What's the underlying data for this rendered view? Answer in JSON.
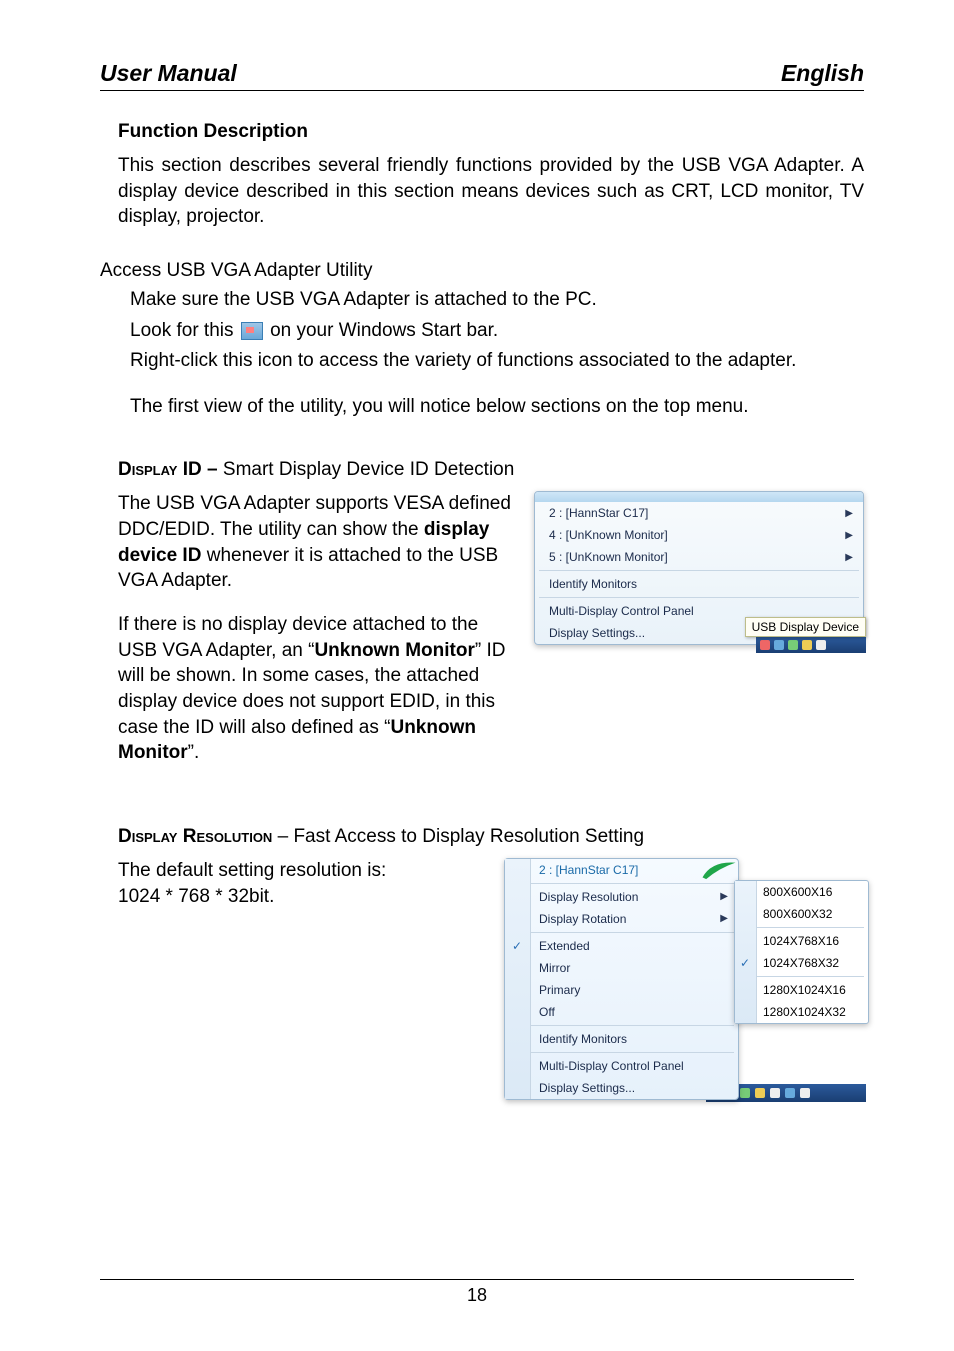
{
  "header": {
    "left": "User Manual",
    "right": "English"
  },
  "section1": {
    "title": "Function Description",
    "para": "This section describes several friendly functions provided by the USB VGA Adapter.  A display device described in this section means devices such as CRT, LCD monitor, TV display, projector."
  },
  "access": {
    "title": "Access USB VGA Adapter Utility",
    "line1": "Make sure the USB VGA Adapter is attached to the PC.",
    "look_pre": "Look for this ",
    "look_post": " on your Windows Start bar.",
    "line3": "Right-click this icon to access the variety of functions associated to the adapter.",
    "line4": "The first view of the utility, you will notice below sections on the top menu."
  },
  "display_id": {
    "heading_pre": "Display ID – ",
    "heading_post": "Smart Display Device ID Detection",
    "p1a": "The USB VGA Adapter supports VESA defined DDC/EDID.  The utility can show the ",
    "p1b": "display device ID",
    "p1c": " whenever it is attached to the USB VGA Adapter.",
    "p2a": "If there is no display device attached to the USB VGA Adapter, an “",
    "p2b": "Unknown Monitor",
    "p2c": "” ID will be shown.  In some cases, the attached display device does not support EDID, in this case the ID will also defined as “",
    "p2d": "Unknown Monitor",
    "p2e": "”."
  },
  "menu1": {
    "items": [
      "2 : [HannStar C17]",
      "4 : [UnKnown Monitor]",
      "5 : [UnKnown Monitor]"
    ],
    "identify": "Identify Monitors",
    "mdpanel": "Multi-Display Control Panel",
    "settings": "Display Settings...",
    "tooltip": "USB Display Device"
  },
  "display_res": {
    "heading_pre": "Display Resolution",
    "heading_post": " – Fast Access to Display Resolution Setting",
    "p1": "The default setting resolution is:",
    "p2": "1024 * 768 * 32bit."
  },
  "menu2": {
    "top": "2 : [HannStar C17]",
    "items": [
      "Display Resolution",
      "Display Rotation",
      "Extended",
      "Mirror",
      "Primary",
      "Off"
    ],
    "identify": "Identify Monitors",
    "mdpanel": "Multi-Display Control Panel",
    "settings": "Display Settings...",
    "resolutions": [
      "800X600X16",
      "800X600X32",
      "1024X768X16",
      "1024X768X32",
      "1280X1024X16",
      "1280X1024X32"
    ]
  },
  "page_number": "18"
}
